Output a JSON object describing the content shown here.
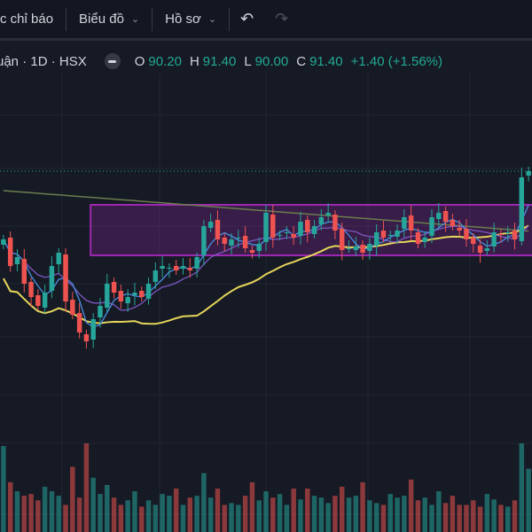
{
  "toolbar": {
    "indicators": "c chỉ báo",
    "chart": "Biểu đồ",
    "profile": "Hồ sơ",
    "chevron": "⌄",
    "undo": "↶",
    "redo": "↷"
  },
  "legend": {
    "symbol": "uận · 1D · HSX",
    "o_label": "O",
    "o": "90.20",
    "h_label": "H",
    "h": "91.40",
    "l_label": "L",
    "l": "90.00",
    "c_label": "C",
    "c": "91.40",
    "change": "+1.40 (+1.56%)"
  },
  "colors": {
    "up": "#26a69a",
    "down": "#ef5350",
    "box": "#9c27b0",
    "ma_short": "#4a90e2",
    "ma_mid": "#7e57c2",
    "ma_long": "#e6d55a",
    "ma_200": "#6b7d4e"
  },
  "chart_data": {
    "type": "candlestick",
    "last_price": 91.4,
    "range_box": {
      "from_index": 13,
      "to_index": 76,
      "top": 89.5,
      "bottom": 86.65
    },
    "closes": [
      87.55,
      86.05,
      86.55,
      85.05,
      84.3,
      83.8,
      84.55,
      86.05,
      86.8,
      84.05,
      83.3,
      82.3,
      81.8,
      83.05,
      83.8,
      85.05,
      84.55,
      84.05,
      84.3,
      84.55,
      84.3,
      85.05,
      85.8,
      86.05,
      85.95,
      85.8,
      86.05,
      85.8,
      86.55,
      88.3,
      88.55,
      87.55,
      87.3,
      87.55,
      87.65,
      87.05,
      86.8,
      87.3,
      89.05,
      87.65,
      87.8,
      87.95,
      87.65,
      88.55,
      87.95,
      88.3,
      88.8,
      89.05,
      88.05,
      86.95,
      87.05,
      87.15,
      86.8,
      87.3,
      87.95,
      87.65,
      87.8,
      88.05,
      88.8,
      88.05,
      87.3,
      87.65,
      88.8,
      89.05,
      88.55,
      88.3,
      88.05,
      87.55,
      87.3,
      86.8,
      87.05,
      87.95,
      87.8,
      87.95,
      87.55,
      91.05,
      91.4
    ],
    "volumes": [
      95,
      55,
      45,
      40,
      42,
      35,
      50,
      45,
      40,
      30,
      72,
      38,
      98,
      60,
      42,
      52,
      38,
      30,
      35,
      45,
      28,
      35,
      30,
      42,
      40,
      48,
      30,
      38,
      40,
      65,
      38,
      48,
      30,
      32,
      30,
      40,
      55,
      35,
      45,
      38,
      42,
      30,
      48,
      36,
      48,
      40,
      38,
      32,
      40,
      50,
      38,
      40,
      55,
      35,
      32,
      30,
      42,
      38,
      40,
      58,
      35,
      38,
      30,
      45,
      32,
      40,
      30,
      30,
      35,
      28,
      42,
      36,
      30,
      28,
      35,
      98,
      70
    ]
  }
}
